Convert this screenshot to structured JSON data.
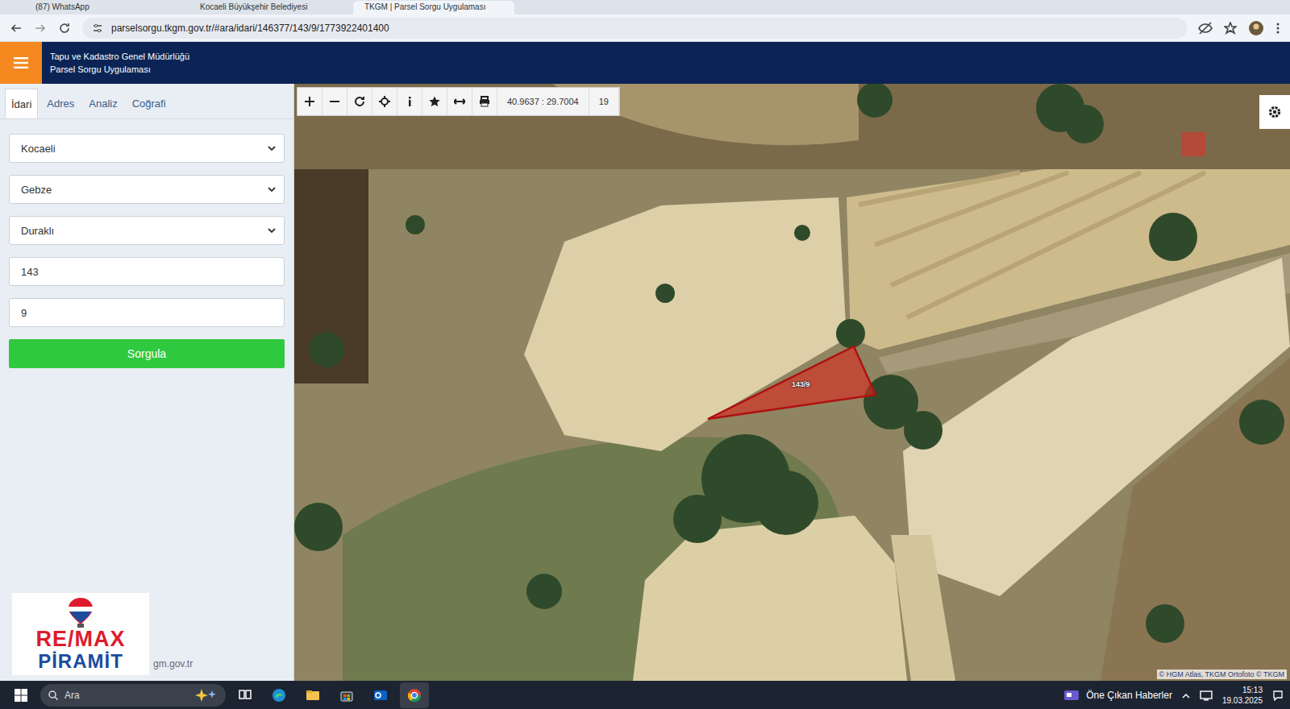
{
  "browser": {
    "tabs": [
      {
        "label": "(87) WhatsApp",
        "selected": false
      },
      {
        "label": "Kocaeli Büyükşehir Belediyesi",
        "selected": false
      },
      {
        "label": "TKGM | Parsel Sorgu Uygulaması",
        "selected": true
      }
    ],
    "url": "parselsorgu.tkgm.gov.tr/#ara/idari/146377/143/9/1773922401400"
  },
  "app": {
    "title": "Tapu ve Kadastro Genel Müdürlüğü",
    "subtitle": "Parsel Sorgu Uygulaması"
  },
  "sidebar": {
    "tabs": [
      {
        "label": "İdari",
        "selected": true
      },
      {
        "label": "Adres",
        "selected": false
      },
      {
        "label": "Analiz",
        "selected": false
      },
      {
        "label": "Coğrafi",
        "selected": false
      }
    ],
    "fields": [
      {
        "kind": "select",
        "value": "Kocaeli"
      },
      {
        "kind": "select",
        "value": "Gebze"
      },
      {
        "kind": "select",
        "value": "Duraklı"
      },
      {
        "kind": "input",
        "value": "143"
      },
      {
        "kind": "input",
        "value": "9"
      }
    ],
    "button": "Sorgula",
    "footer": "gm.gov.tr"
  },
  "map": {
    "coords": "40.9637 : 29.7004",
    "zoom": "19",
    "parcel": "143/9",
    "attribution": "© HGM Atlas, TKGM Ortofoto © TKGM"
  },
  "watermark": {
    "brand": "RE/MAX",
    "office": "PİRAMİT"
  },
  "taskbar": {
    "search": "Ara",
    "news": "Öne Çıkan Haberler",
    "time": "15:13",
    "date": "19.03.2025"
  }
}
